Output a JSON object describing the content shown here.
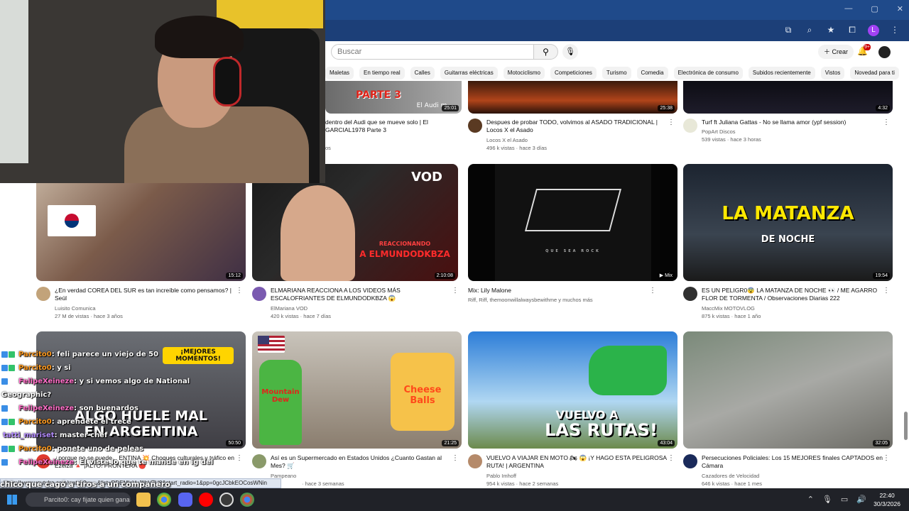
{
  "youtube": {
    "search_placeholder": "Buscar",
    "create_label": "Crear",
    "notif_count": "9+",
    "chips": [
      "Maletas",
      "En tiempo real",
      "Calles",
      "Guitarras eléctricas",
      "Motociclismo",
      "Competiciones",
      "Turismo",
      "Comedia",
      "Electrónica de consumo",
      "Subidos recientemente",
      "Vistos",
      "Novedad para ti"
    ]
  },
  "thumb_texts": {
    "r0c0_caption": "PARTE 3",
    "r0c0_brand": "El Audi m",
    "vod_label": "VOD",
    "reacc": "REACCIONANDO",
    "reacc2": "A ELMUNDODKBZA",
    "riff_sub": "QUE SEA ROCK",
    "matanza": "LA MATANZA",
    "matanza2": "DE NOCHE",
    "mejores": "¡MEJORES MOMENTOS!",
    "algo1": "ALGO HUELE MAL",
    "algo2": "EN ARGENTINA",
    "dew": "Mountain Dew",
    "cheese": "Cheese Balls",
    "vuelvo1": "VUELVO A",
    "vuelvo2": "LAS RUTAS!"
  },
  "videos": [
    {
      "title": "dentro del Audi que se mueve solo | El GARCIAL1978 Parte 3",
      "channel": "",
      "stats": "os",
      "duration": "25:01"
    },
    {
      "title": "Despues de probar TODO, volvimos al ASADO TRADICIONAL | Locos X el Asado",
      "channel": "Locos X el Asado",
      "stats": "496 k vistas · hace 3 días",
      "duration": "25:38"
    },
    {
      "title": "Turf ft Juliana Gattas - No se llama amor  (ypf session)",
      "channel": "PopArt Discos",
      "stats": "539 vistas · hace 3 horas",
      "duration": "4:32"
    },
    {
      "title": "¿En verdad COREA DEL SUR es tan increíble como pensamos? | Seúl",
      "channel": "Luisito Comunica",
      "stats": "27 M de vistas · hace 3 años",
      "duration": "15:12"
    },
    {
      "title": "ELMARIANA REACCIONA A LOS VIDEOS MÁS ESCALOFRIANTES DE ELMUNDODKBZA 😱",
      "channel": "ElMariana VOD",
      "stats": "420 k vistas · hace 7 días",
      "duration": "2:10:08"
    },
    {
      "title": "Mix: Lily Malone",
      "channel": "Riff, Riff, themoonwillalwaysbewithme y muchos más",
      "stats": "",
      "duration": "Mix"
    },
    {
      "title": "ES UN PELIGR0😨 LA MATANZA DE NOCHE 👀 / ME AGARRO FLOR DE TORMENTA / Observaciones Diarias 222",
      "channel": "MaccMix MOTOVLOG",
      "stats": "875 k vistas · hace 1 año",
      "duration": "19:54"
    },
    {
      "title": "¿porque no se puede... ENTINA 💥 Choques culturales y tráfico en Ezeiza 🔺 ¡ALTO! FRONTERA 🔴",
      "channel": "",
      "stats": "",
      "duration": "50:50"
    },
    {
      "title": "Así es un Supermercado en Estados Unidos ¿Cuanto Gastan al Mes? 🛒",
      "channel": "Pampeano",
      "stats": "· hace 3 semanas",
      "duration": "21:25"
    },
    {
      "title": "VUELVO A VIAJAR EN MOTO 🏍 😱 ¡Y HAGO ESTA PELIGROSA RUTA! | ARGENTINA",
      "channel": "Pablo Imhoff",
      "stats": "954 k vistas · hace 2 semanas",
      "duration": "43:04"
    },
    {
      "title": "Persecuciones Policiales: Los 15 MEJORES finales CAPTADOS en Cámara",
      "channel": "Cazadores de Velocidad",
      "stats": "646 k vistas · hace 1 mes",
      "duration": "32:05"
    }
  ],
  "chat": [
    {
      "user": "Parcito0",
      "text": ": feli parece un viejo de 50"
    },
    {
      "user": "Parcito0",
      "text": ": y si"
    },
    {
      "user": "FelipeXeineze",
      "text": ": y si vemos algo de National"
    },
    {
      "user": "",
      "text": "Geographic?"
    },
    {
      "user": "FelipeXeineze",
      "text": ": son buenardos"
    },
    {
      "user": "Parcito0",
      "text": ": aprendete el trece"
    },
    {
      "user": "tatti_mariset",
      "text": ": master chef"
    },
    {
      "user": "Parcito0",
      "text": ": ponete uno de peleas"
    },
    {
      "user": "FelipeXeineze",
      "text": ": El viste lo que te mande en ig del"
    }
  ],
  "status_url": "https://www.youtube.com/watch?v=...&list=RDEMIcVyJIIbV7U8&start_radio=1&pp=0gcJCbkEOCosWNin",
  "caption": "chico que cagó a tiros a un compañero",
  "taskbar": {
    "search_text": "Parcito0: cay fijate quien gana",
    "time": "22:40",
    "date": "30/3/2026"
  },
  "colors": {
    "chrome_title": "#1f4a8a",
    "chrome_addr": "#1c3f78",
    "taskbar": "#202228",
    "accent_red": "#cc0000"
  }
}
